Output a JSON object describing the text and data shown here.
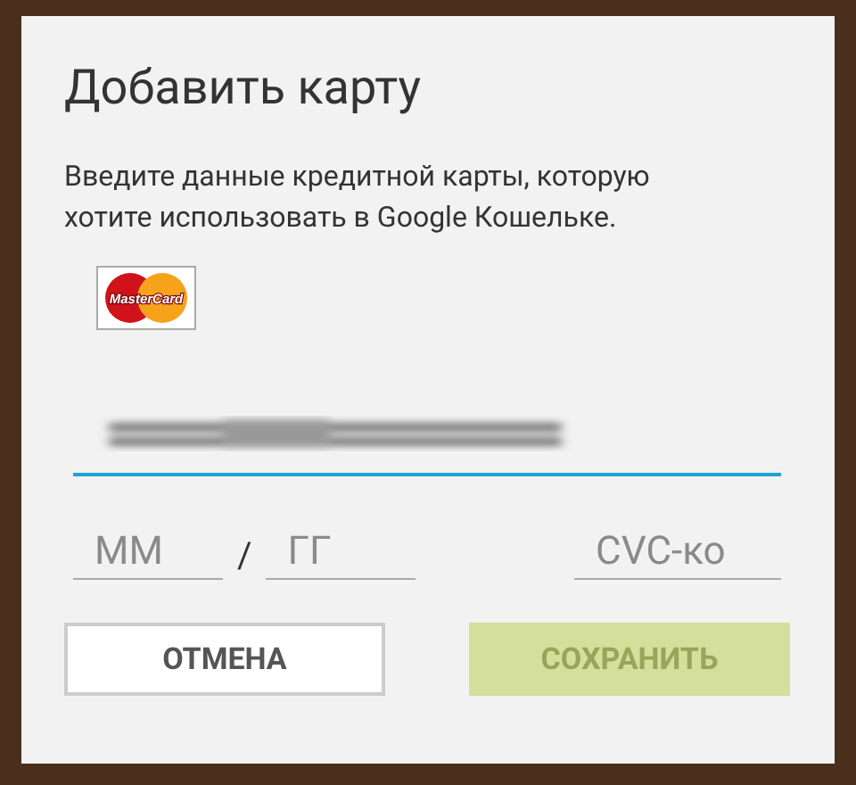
{
  "dialog": {
    "title": "Добавить карту",
    "message": "Введите данные кредитной карты, которую хотите использовать в Google Кошельке.",
    "card_logo": {
      "text": "MasterCard"
    },
    "card_number": {
      "obscured": true,
      "focused": true
    },
    "expiry_month": {
      "placeholder": "ММ"
    },
    "expiry_separator": "/",
    "expiry_year": {
      "placeholder": "ГГ"
    },
    "cvc": {
      "placeholder": "CVC-ко"
    },
    "buttons": [
      {
        "label": "ОТМЕНА",
        "kind": "cancel",
        "disabled": false
      },
      {
        "label": "СОХРАНИТЬ",
        "kind": "save",
        "disabled": true
      }
    ]
  }
}
